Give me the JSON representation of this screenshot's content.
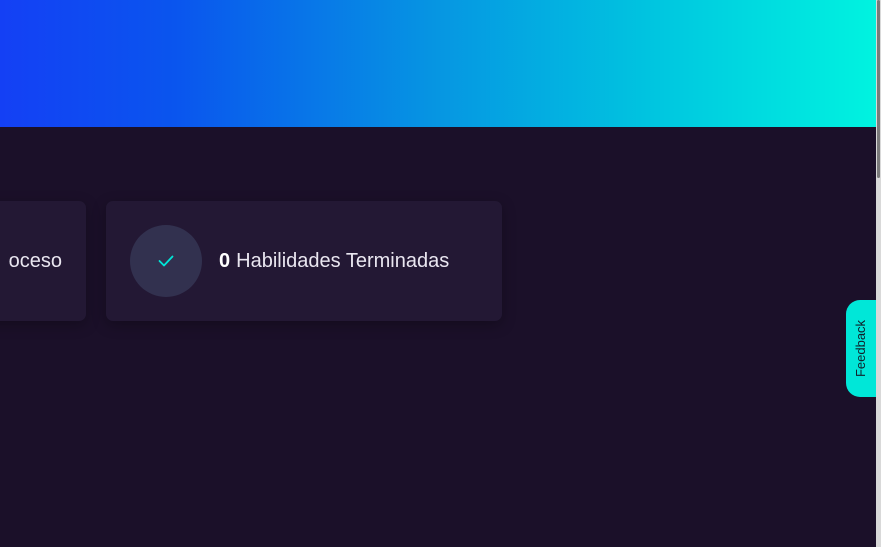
{
  "banner": {
    "colors": [
      "#1440f5",
      "#0696e2",
      "#00f3e0"
    ]
  },
  "cards": {
    "in_progress": {
      "label_visible": "oceso"
    },
    "completed": {
      "icon": "check-icon",
      "count": "0",
      "label": "Habilidades Terminadas"
    }
  },
  "feedback": {
    "label": "Feedback"
  },
  "colors": {
    "background": "#1b1029",
    "card": "#231834",
    "accent": "#00e7d8"
  }
}
